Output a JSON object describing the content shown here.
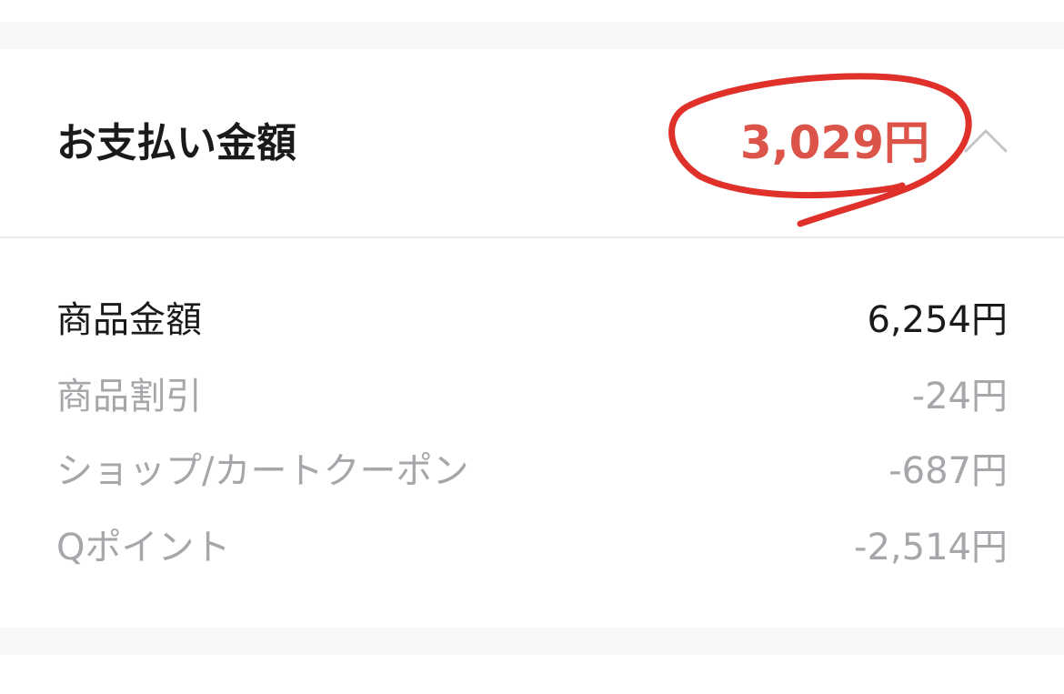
{
  "summary": {
    "title": "お支払い金額",
    "total": "3,029円"
  },
  "breakdown": [
    {
      "label": "商品金額",
      "value": "6,254円"
    },
    {
      "label": "商品割引",
      "value": "-24円"
    },
    {
      "label": "ショップ/カートクーポン",
      "value": "-687円"
    },
    {
      "label": "Qポイント",
      "value": "-2,514円"
    }
  ],
  "colors": {
    "total_amount": "#dc5349",
    "handwritten_circle": "#e0302a",
    "primary_text": "#1a1a1a",
    "muted_text": "#a6a6ab"
  },
  "icons": {
    "collapse": "chevron-up-icon"
  }
}
